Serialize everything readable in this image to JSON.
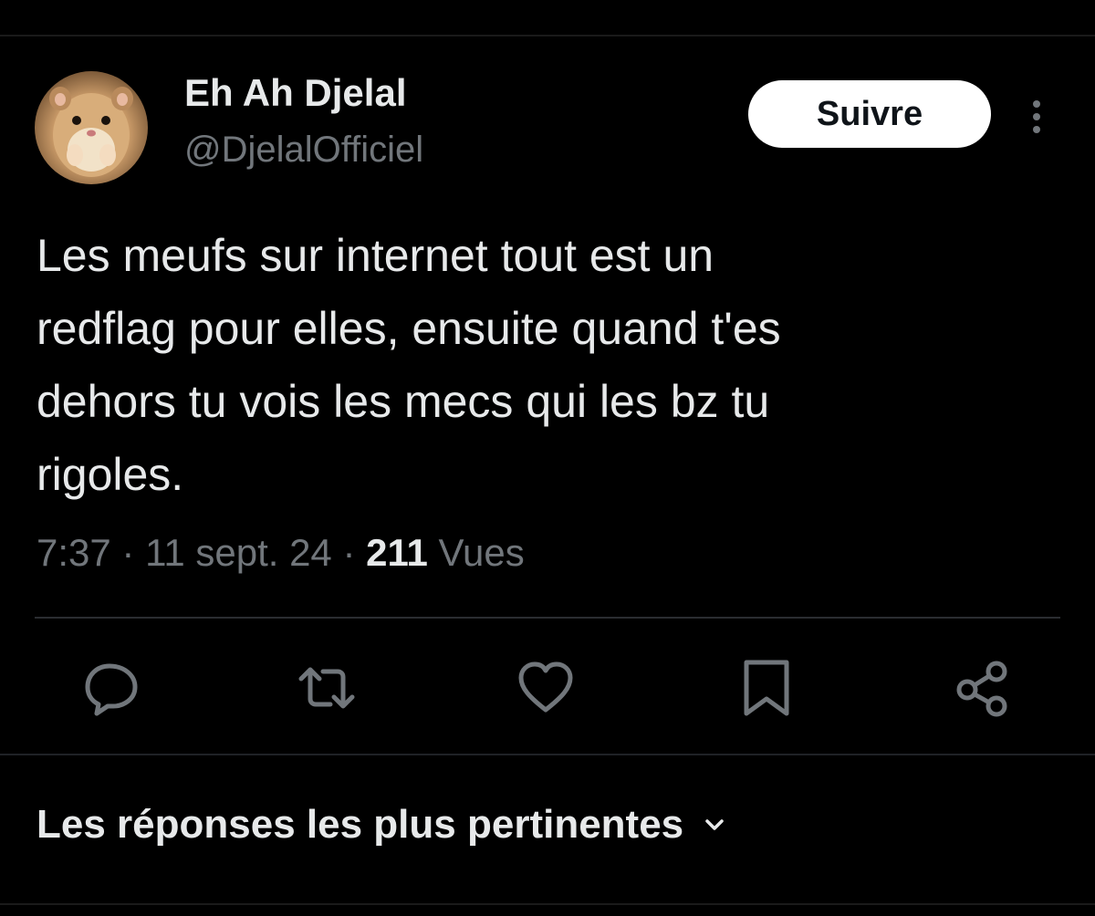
{
  "author": {
    "display_name": "Eh Ah Djelal",
    "handle": "@DjelalOfficiel",
    "avatar_icon": "hamster-avatar"
  },
  "follow_button": {
    "label": "Suivre"
  },
  "tweet": {
    "lines": [
      "Les meufs sur internet tout est un",
      "redflag pour elles, ensuite quand t'es",
      "dehors tu vois les mecs qui les bz tu",
      "rigoles."
    ]
  },
  "meta": {
    "time": "7:37",
    "separator": " · ",
    "date": "11 sept. 24",
    "views_count": "211",
    "views_label": " Vues"
  },
  "actions": [
    {
      "name": "reply",
      "icon": "reply-icon"
    },
    {
      "name": "retweet",
      "icon": "retweet-icon"
    },
    {
      "name": "like",
      "icon": "heart-icon"
    },
    {
      "name": "bookmark",
      "icon": "bookmark-icon"
    },
    {
      "name": "share",
      "icon": "share-icon"
    }
  ],
  "replies_sort": {
    "label": "Les réponses les plus pertinentes"
  },
  "colors": {
    "background": "#000000",
    "primary_text": "#e7e9ea",
    "secondary_text": "#71767b",
    "follow_bg": "#ffffff",
    "follow_text": "#0f1419"
  }
}
